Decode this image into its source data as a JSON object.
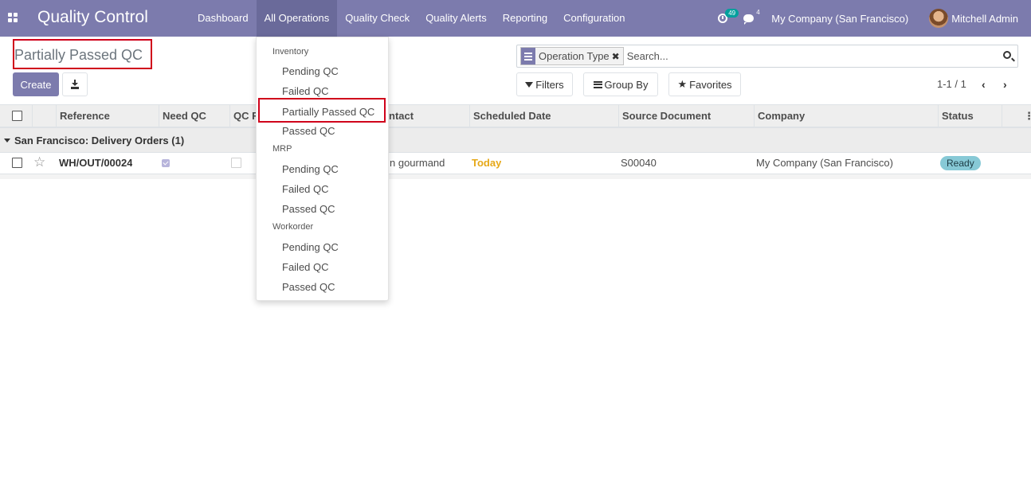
{
  "navbar": {
    "brand": "Quality Control",
    "menu": [
      "Dashboard",
      "All Operations",
      "Quality Check",
      "Quality Alerts",
      "Reporting",
      "Configuration"
    ],
    "activities_count": "49",
    "messages_count": "4",
    "company": "My Company (San Francisco)",
    "user": "Mitchell Admin"
  },
  "control_panel": {
    "title": "Partially Passed QC",
    "create_label": "Create",
    "facet_label": "Operation Type",
    "search_placeholder": "Search...",
    "filters_label": "Filters",
    "groupby_label": "Group By",
    "favorites_label": "Favorites",
    "pager": "1-1 / 1"
  },
  "table": {
    "columns": [
      "Reference",
      "Need QC",
      "QC F",
      "ntact",
      "Scheduled Date",
      "Source Document",
      "Company",
      "Status"
    ],
    "group_label": "San Francisco: Delivery Orders (1)",
    "row": {
      "reference": "WH/OUT/00024",
      "contact": "n gourmand",
      "scheduled": "Today",
      "source": "S00040",
      "company": "My Company (San Francisco)",
      "status": "Ready"
    }
  },
  "dropdown": {
    "sections": [
      {
        "header": "Inventory",
        "items": [
          "Pending QC",
          "Failed QC",
          "Partially Passed QC",
          "Passed QC"
        ]
      },
      {
        "header": "MRP",
        "items": [
          "Pending QC",
          "Failed QC",
          "Passed QC"
        ]
      },
      {
        "header": "Workorder",
        "items": [
          "Pending QC",
          "Failed QC",
          "Passed QC"
        ]
      }
    ]
  },
  "colors": {
    "primary": "#7c7bad",
    "highlight_border": "#d0021b",
    "today": "#e6a817",
    "status_ready": "#87c9d6"
  }
}
